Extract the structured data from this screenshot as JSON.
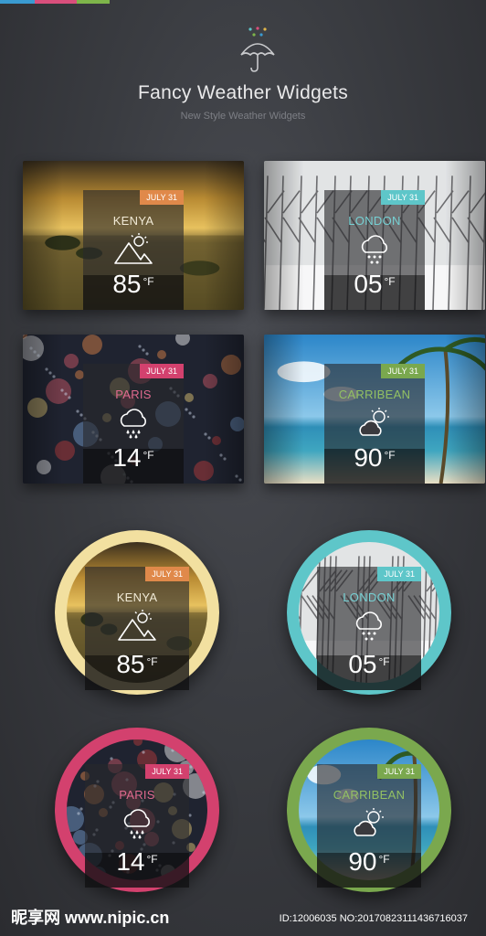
{
  "header": {
    "title": "Fancy Weather Widgets",
    "subtitle": "New Style Weather Widgets",
    "top_bar_colors": [
      "#3a9bd1",
      "#d94f7c",
      "#7eb54a",
      "#3a3c41",
      "#d9c36a",
      "#5ec6c9"
    ]
  },
  "cards": [
    {
      "city": "KENYA",
      "date": "JULY 31",
      "temp": "85",
      "unit": "°F",
      "icon": "mountain-sun-icon",
      "accent": "#e0894a",
      "city_color": "#f1ead6",
      "scene": "savanna-sunset"
    },
    {
      "city": "LONDON",
      "date": "JULY 31",
      "temp": "05",
      "unit": "°F",
      "icon": "snow-cloud-icon",
      "accent": "#5ec6c9",
      "city_color": "#76d0d3",
      "scene": "snowy-trees"
    },
    {
      "city": "PARIS",
      "date": "JULY 31",
      "temp": "14",
      "unit": "°F",
      "icon": "rain-cloud-icon",
      "accent": "#d3416e",
      "city_color": "#e06a8f",
      "scene": "rainy-city"
    },
    {
      "city": "CARRIBEAN",
      "date": "JULY 31",
      "temp": "90",
      "unit": "°F",
      "icon": "sun-cloud-icon",
      "accent": "#7aa84e",
      "city_color": "#93c163",
      "scene": "tropical-beach"
    }
  ],
  "rings": [
    {
      "city": "KENYA",
      "date": "JULY 31",
      "temp": "85",
      "unit": "°F",
      "icon": "mountain-sun-icon",
      "accent": "#e0894a",
      "ring_color": "#f2e0a0",
      "city_color": "#f1ead6"
    },
    {
      "city": "LONDON",
      "date": "JULY 31",
      "temp": "05",
      "unit": "°F",
      "icon": "snow-cloud-icon",
      "accent": "#5ec6c9",
      "ring_color": "#5ec6c9",
      "city_color": "#76d0d3"
    },
    {
      "city": "PARIS",
      "date": "JULY 31",
      "temp": "14",
      "unit": "°F",
      "icon": "rain-cloud-icon",
      "accent": "#d3416e",
      "ring_color": "#d3416e",
      "city_color": "#e06a8f"
    },
    {
      "city": "CARRIBEAN",
      "date": "JULY 31",
      "temp": "90",
      "unit": "°F",
      "icon": "sun-cloud-icon",
      "accent": "#7aa84e",
      "ring_color": "#7aa84e",
      "city_color": "#93c163"
    }
  ],
  "watermark": {
    "site": "昵享网 www.nipic.cn",
    "id_line": "ID:12006035 NO:20170823111436716037"
  }
}
